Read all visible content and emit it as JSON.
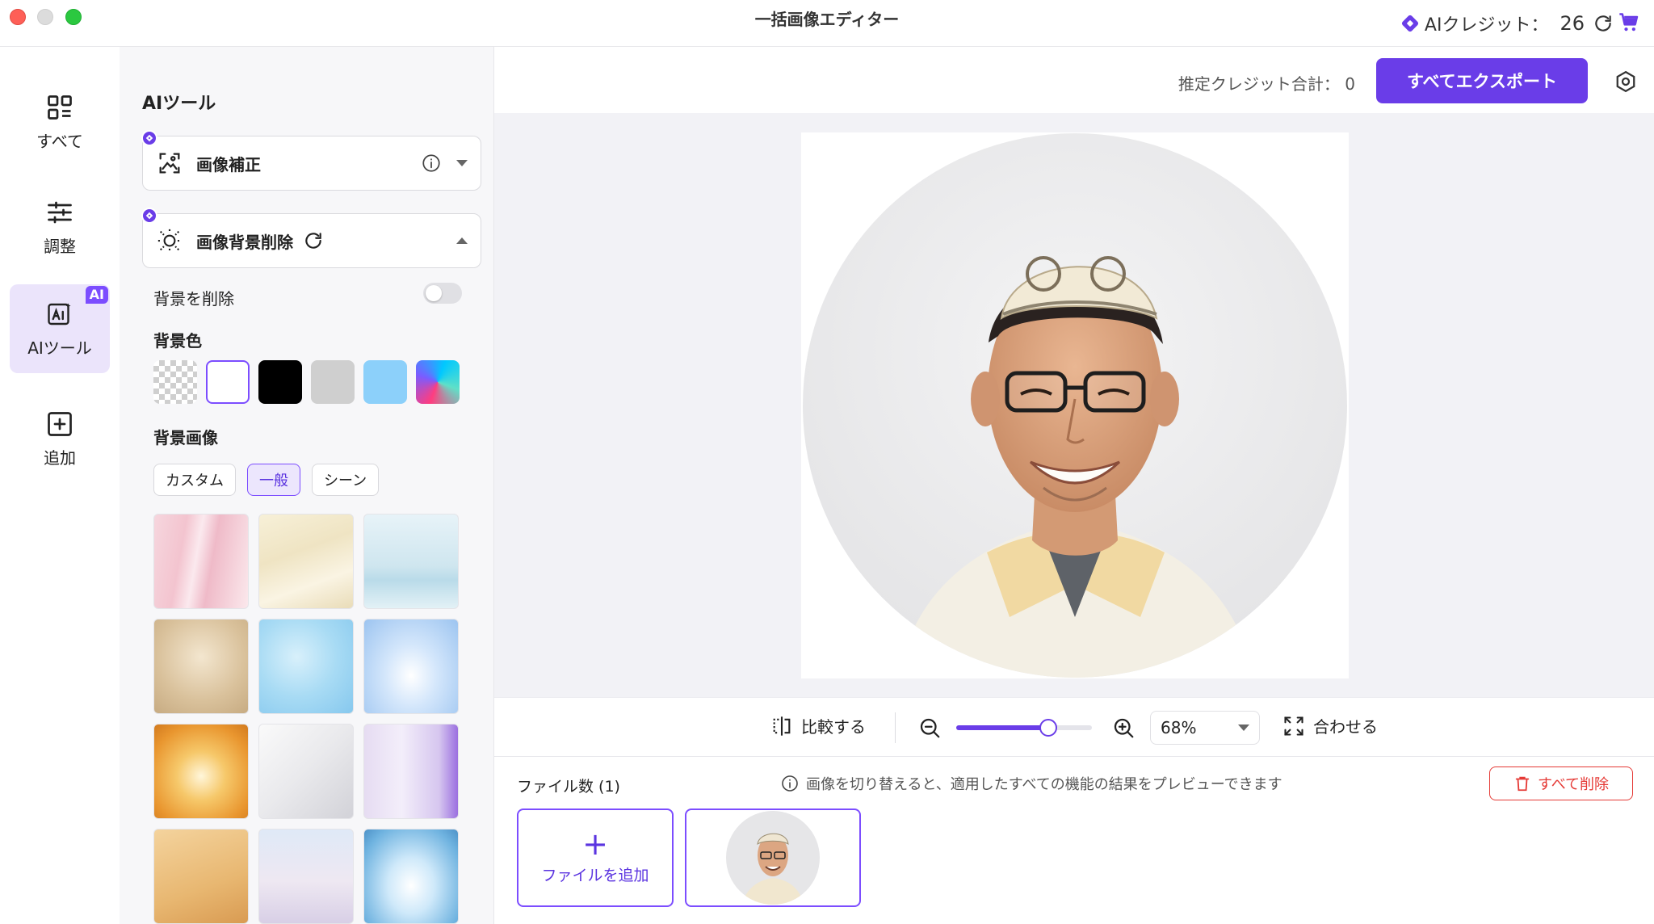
{
  "window": {
    "title": "一括画像エディター"
  },
  "credits": {
    "label": "AIクレジット：",
    "value": "26"
  },
  "rail": [
    {
      "label": "すべて",
      "icon": "grid-icon"
    },
    {
      "label": "調整",
      "icon": "sliders-icon"
    },
    {
      "label": "AIツール",
      "icon": "ai-tool-icon",
      "badge": "AI"
    },
    {
      "label": "追加",
      "icon": "plus-square-icon"
    }
  ],
  "panel": {
    "title": "AIツール",
    "tools": [
      {
        "label": "画像補正",
        "expanded": false
      },
      {
        "label": "画像背景削除",
        "expanded": true
      }
    ],
    "remove_bg_label": "背景を削除",
    "remove_bg_enabled": false,
    "bg_color_label": "背景色",
    "bg_colors": [
      "transparent",
      "#ffffff",
      "#000000",
      "#cfcfcf",
      "#8cd0fa",
      "gradient"
    ],
    "bg_color_selected": "#ffffff",
    "bg_image_label": "背景画像",
    "bg_image_tabs": [
      "カスタム",
      "一般",
      "シーン"
    ],
    "bg_image_tab_active": "一般"
  },
  "main": {
    "estimate_label": "推定クレジット合計：",
    "estimate_value": "0",
    "export_label": "すべてエクスポート",
    "compare_label": "比較する",
    "zoom_value": "68%",
    "zoom_level": 0.68,
    "fit_label": "合わせる",
    "files_count_label": "ファイル数 (1)",
    "hint_text": "画像を切り替えると、適用したすべての機能の結果をプレビューできます",
    "delete_all_label": "すべて削除",
    "add_file_label": "ファイルを追加"
  },
  "colors": {
    "accent": "#6a3de8",
    "danger": "#e53935"
  }
}
